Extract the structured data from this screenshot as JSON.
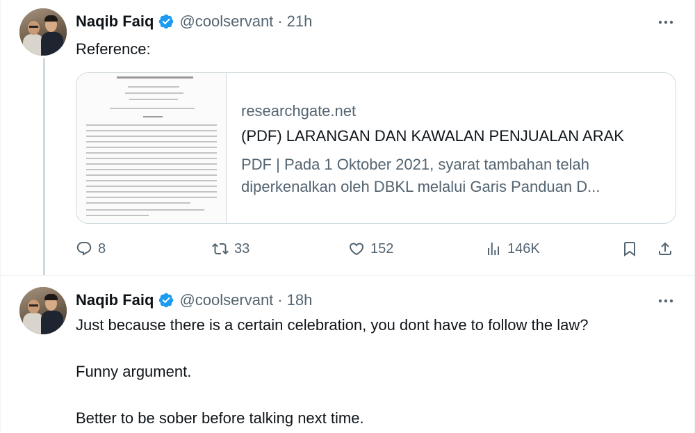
{
  "tweets": [
    {
      "author": {
        "name": "Naqib Faiq",
        "handle": "@coolservant",
        "verified": true
      },
      "separator": "·",
      "time": "21h",
      "text": "Reference:",
      "card": {
        "domain": "researchgate.net",
        "title": "(PDF) LARANGAN DAN KAWALAN PENJUALAN ARAK",
        "description": "PDF | Pada 1 Oktober 2021, syarat tambahan telah diperkenalkan oleh DBKL melalui Garis Panduan D..."
      },
      "actions": {
        "replies": "8",
        "retweets": "33",
        "likes": "152",
        "views": "146K"
      }
    },
    {
      "author": {
        "name": "Naqib Faiq",
        "handle": "@coolservant",
        "verified": true
      },
      "separator": "·",
      "time": "18h",
      "paragraphs": [
        "Just because there is a certain celebration, you dont have to follow the law?",
        "Funny argument.",
        "Better to be sober before talking next time."
      ]
    }
  ],
  "colors": {
    "verified": "#1d9bf0",
    "secondary_text": "#536471",
    "primary_text": "#0f1419",
    "border": "#cfd9de"
  },
  "icons": [
    "verified-badge-icon",
    "more-icon",
    "reply-icon",
    "retweet-icon",
    "like-icon",
    "views-icon",
    "bookmark-icon",
    "share-icon"
  ]
}
